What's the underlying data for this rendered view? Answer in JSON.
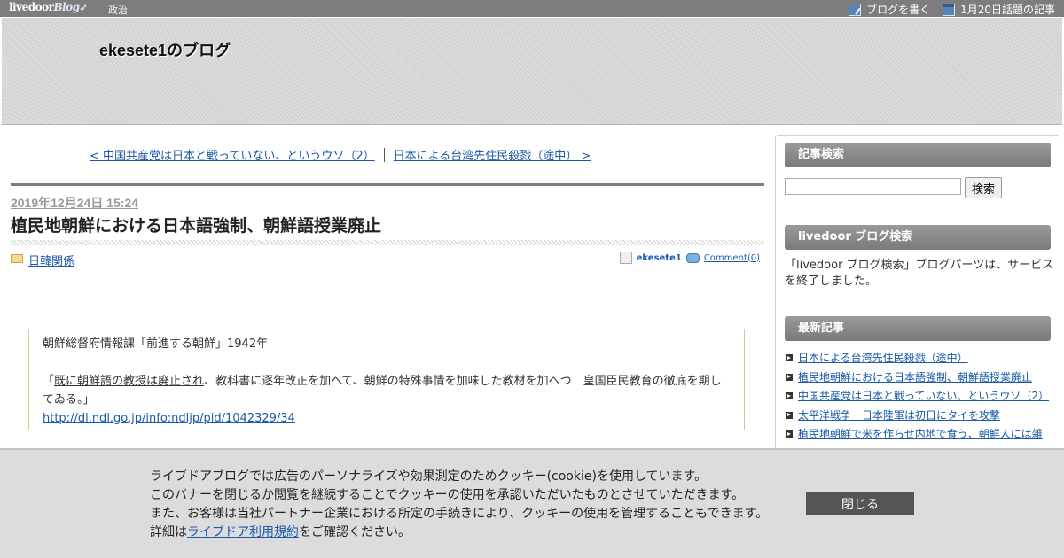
{
  "topbar": {
    "logo_main": "livedoor",
    "logo_blog": "Blog",
    "category": "政治",
    "write_blog": "ブログを書く",
    "topic_articles": "1月20日話題の記事"
  },
  "header": {
    "blog_title": "ekesete1のブログ"
  },
  "nav": {
    "prev": "< 中国共産党は日本と戦っていない、というウソ（2）",
    "next": "日本による台湾先住民殺戮（途中） >"
  },
  "article": {
    "date": "2019年12月24日 15:24",
    "title": "植民地朝鮮における日本語強制、朝鮮語授業廃止",
    "category": "日韓関係",
    "author": "ekesete1",
    "comments": "Comment(0)",
    "quote": {
      "source": "朝鮮総督府情報課「前進する朝鮮」1942年",
      "open": "「",
      "underlined": "既に朝鮮語の教授は廃止され",
      "rest": "、教科書に逐年改正を加へて、朝鮮の特殊事情を加味した教材を加へつ　皇国臣民教育の徹底を期してゐる。」",
      "link": "http://dl.ndl.go.jp/info:ndljp/pid/1042329/34"
    }
  },
  "sidebar": {
    "search_heading": "記事検索",
    "search_button": "検索",
    "ld_search_heading": "livedoor ブログ検索",
    "ld_search_text": "「livedoor ブログ検索」ブログパーツは、サービスを終了しました。",
    "recent_heading": "最新記事",
    "recent": [
      "日本による台湾先住民殺戮（途中）",
      "植民地朝鮮における日本語強制、朝鮮語授業廃止",
      "中国共産党は日本と戦っていない、というウソ（2）",
      "太平洋戦争　日本陸軍は初日にタイを攻撃",
      "植民地朝鮮で米を作らせ内地で食う、朝鮮人には雑"
    ]
  },
  "cookie": {
    "line1": "ライブドアブログでは広告のパーソナライズや効果測定のためクッキー(cookie)を使用しています。",
    "line2": "このバナーを閉じるか閲覧を継続することでクッキーの使用を承認いただいたものとさせていただきます。",
    "line3": "また、お客様は当社パートナー企業における所定の手続きにより、クッキーの使用を管理することもできます。",
    "line4_prefix": "詳細は",
    "line4_link": "ライブドア利用規約",
    "line4_suffix": "をご確認ください。",
    "close_button": "閉じる"
  }
}
